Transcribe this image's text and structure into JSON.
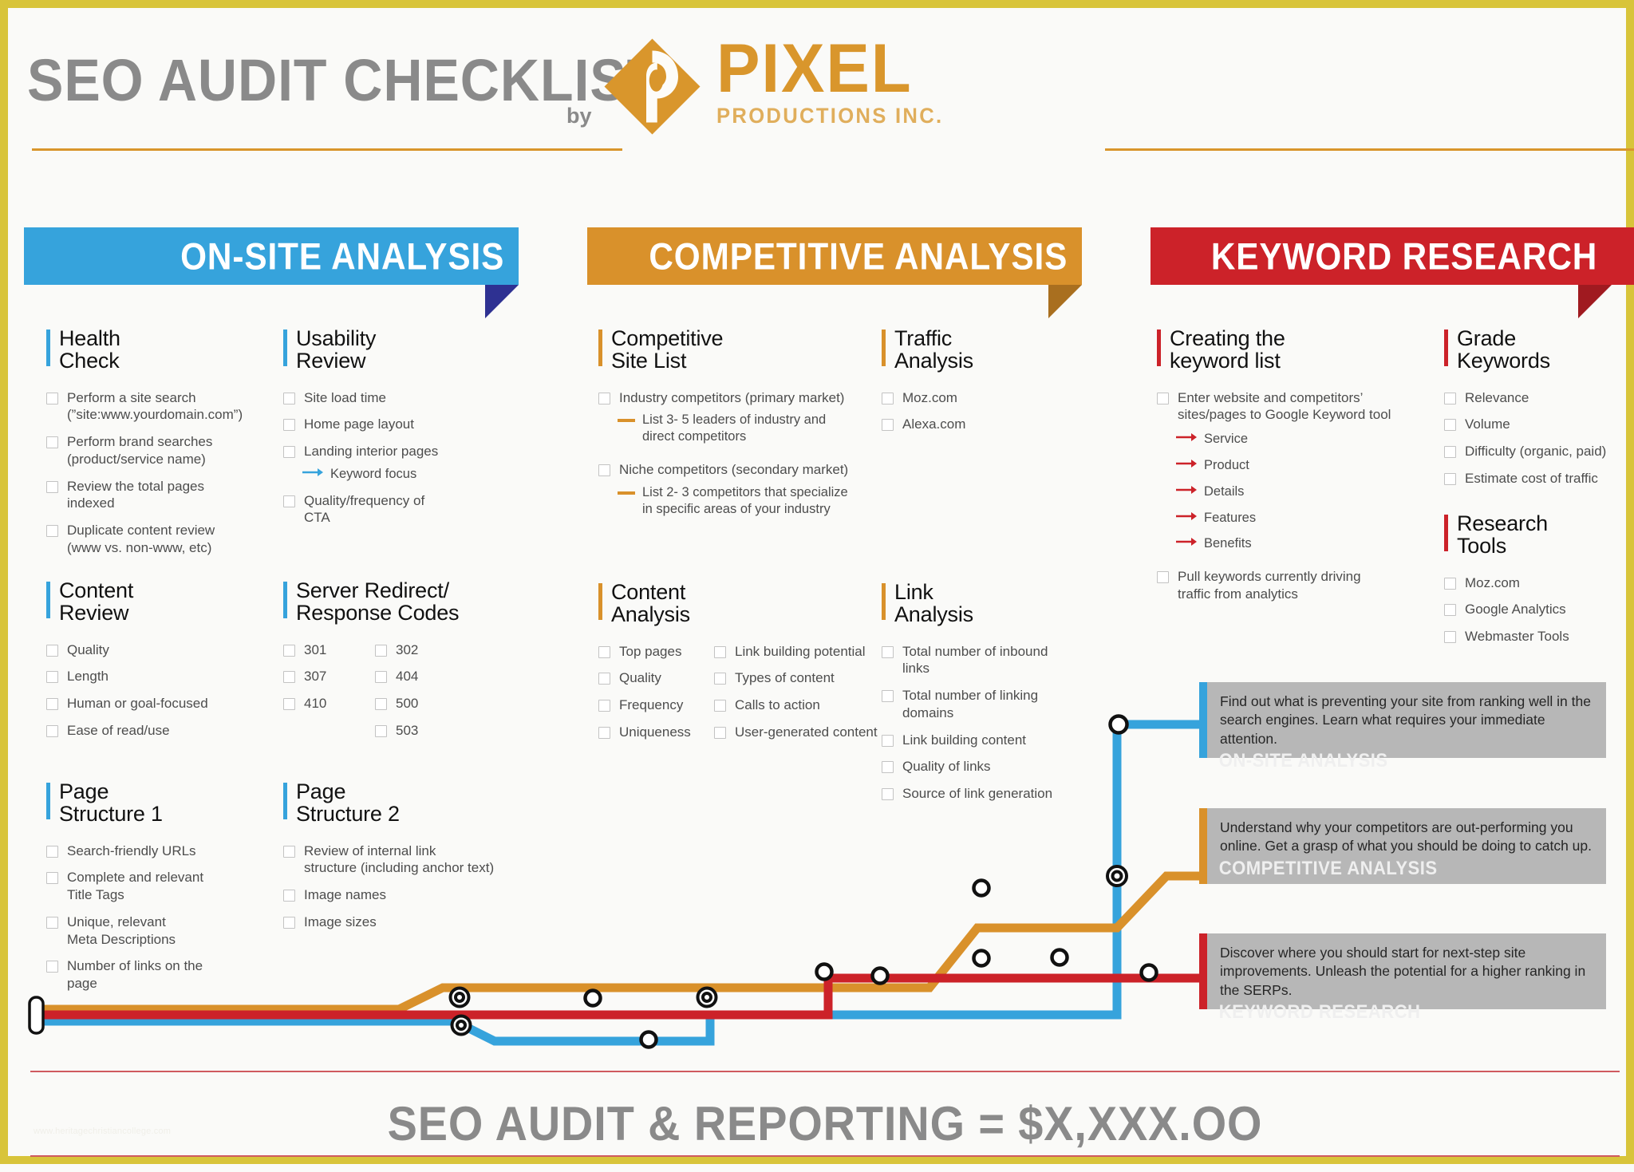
{
  "header": {
    "title": "SEO AUDIT CHECKLIST",
    "by": "by",
    "logo_name": "PIXEL",
    "logo_sub": "PRODUCTIONS INC."
  },
  "colors": {
    "blue": "#36a3dc",
    "blue_fold": "#2e3192",
    "orange": "#d9912b",
    "orange_fold": "#a96f1f",
    "red": "#cc2229",
    "red_fold": "#a01a20",
    "gold_border": "#d8c43a",
    "callout_bg": "#b7b7b7",
    "title_gray": "#8a8a8a"
  },
  "banners": [
    {
      "label": "ON-SITE ANALYSIS",
      "color": "#36a3dc",
      "fold": "#2e3192"
    },
    {
      "label": "COMPETITIVE ANALYSIS",
      "color": "#d9912b",
      "fold": "#a96f1f"
    },
    {
      "label": "KEYWORD RESEARCH",
      "color": "#cc2229",
      "fold": "#a01a20"
    }
  ],
  "groups": {
    "health_check": {
      "title": "Health\nCheck",
      "items": [
        "Perform a site search\n(”site:www.yourdomain.com”)",
        "Perform brand searches\n(product/service name)",
        "Review the total pages\nindexed",
        "Duplicate content review\n(www vs. non-www, etc)"
      ]
    },
    "usability_review": {
      "title": "Usability\nReview",
      "items": [
        "Site load time",
        "Home page layout",
        "Landing interior pages",
        "Quality/frequency of\nCTA"
      ],
      "sub_after_3": "Keyword focus"
    },
    "content_review": {
      "title": "Content\nReview",
      "items": [
        "Quality",
        "Length",
        "Human or goal-focused",
        "Ease of read/use"
      ]
    },
    "server_redirect": {
      "title": "Server Redirect/\nResponse Codes",
      "col_a": [
        "301",
        "307",
        "410"
      ],
      "col_b": [
        "302",
        "404",
        "500",
        "503"
      ]
    },
    "page_structure_1": {
      "title": "Page\nStructure 1",
      "items": [
        "Search-friendly URLs",
        "Complete and relevant\nTitle Tags",
        "Unique, relevant\nMeta Descriptions",
        "Number of links on the\npage"
      ]
    },
    "page_structure_2": {
      "title": "Page\nStructure 2",
      "items": [
        "Review of internal link\nstructure (including anchor text)",
        "Image names",
        "Image sizes"
      ]
    },
    "competitive_site_list": {
      "title": "Competitive\nSite List",
      "items": [
        "Industry competitors (primary market)",
        "Niche competitors (secondary market)"
      ],
      "subs": [
        "List 3- 5 leaders of industry and\ndirect competitors",
        "List 2- 3 competitors that specialize\nin specific areas of your industry"
      ]
    },
    "traffic_analysis": {
      "title": "Traffic\nAnalysis",
      "items": [
        "Moz.com",
        "Alexa.com"
      ]
    },
    "content_analysis": {
      "title": "Content\nAnalysis",
      "col_a": [
        "Top pages",
        "Quality",
        "Frequency",
        "Uniqueness"
      ],
      "col_b": [
        "Link building potential",
        "Types of content",
        "Calls to action",
        "User-generated content"
      ]
    },
    "link_analysis": {
      "title": "Link\nAnalysis",
      "items": [
        "Total number of inbound\nlinks",
        "Total number of linking\ndomains",
        "Link building content",
        "Quality of links",
        "Source of link generation"
      ]
    },
    "creating_keyword_list": {
      "title": "Creating the\nkeyword list",
      "items": [
        "Enter website and competitors’\nsites/pages to Google Keyword tool",
        "Pull keywords currently driving\ntraffic from analytics"
      ],
      "arrows": [
        "Service",
        "Product",
        "Details",
        "Features",
        "Benefits"
      ]
    },
    "grade_keywords": {
      "title": "Grade\nKeywords",
      "items": [
        "Relevance",
        "Volume",
        "Difficulty (organic, paid)",
        "Estimate cost of traffic"
      ]
    },
    "research_tools": {
      "title": "Research\nTools",
      "items": [
        "Moz.com",
        "Google Analytics",
        "Webmaster Tools"
      ]
    }
  },
  "callouts": [
    {
      "text": "Find out what is preventing your site from ranking well in the search engines. Learn what requires your immediate attention.",
      "tag": "ON-SITE ANALYSIS",
      "color": "#36a3dc"
    },
    {
      "text": "Understand why your competitors are out-performing you online. Get a grasp of what you should be doing to catch up.",
      "tag": "COMPETITIVE ANALYSIS",
      "color": "#d9912b"
    },
    {
      "text": "Discover where you should start for next-step site improvements. Unleash the potential for a higher ranking in the SERPs.",
      "tag": "KEYWORD RESEARCH",
      "color": "#cc2229"
    }
  ],
  "footer": {
    "title": "SEO AUDIT & REPORTING = $X,XXX.OO",
    "watermark": "www.heritagechristiancollege.com"
  }
}
